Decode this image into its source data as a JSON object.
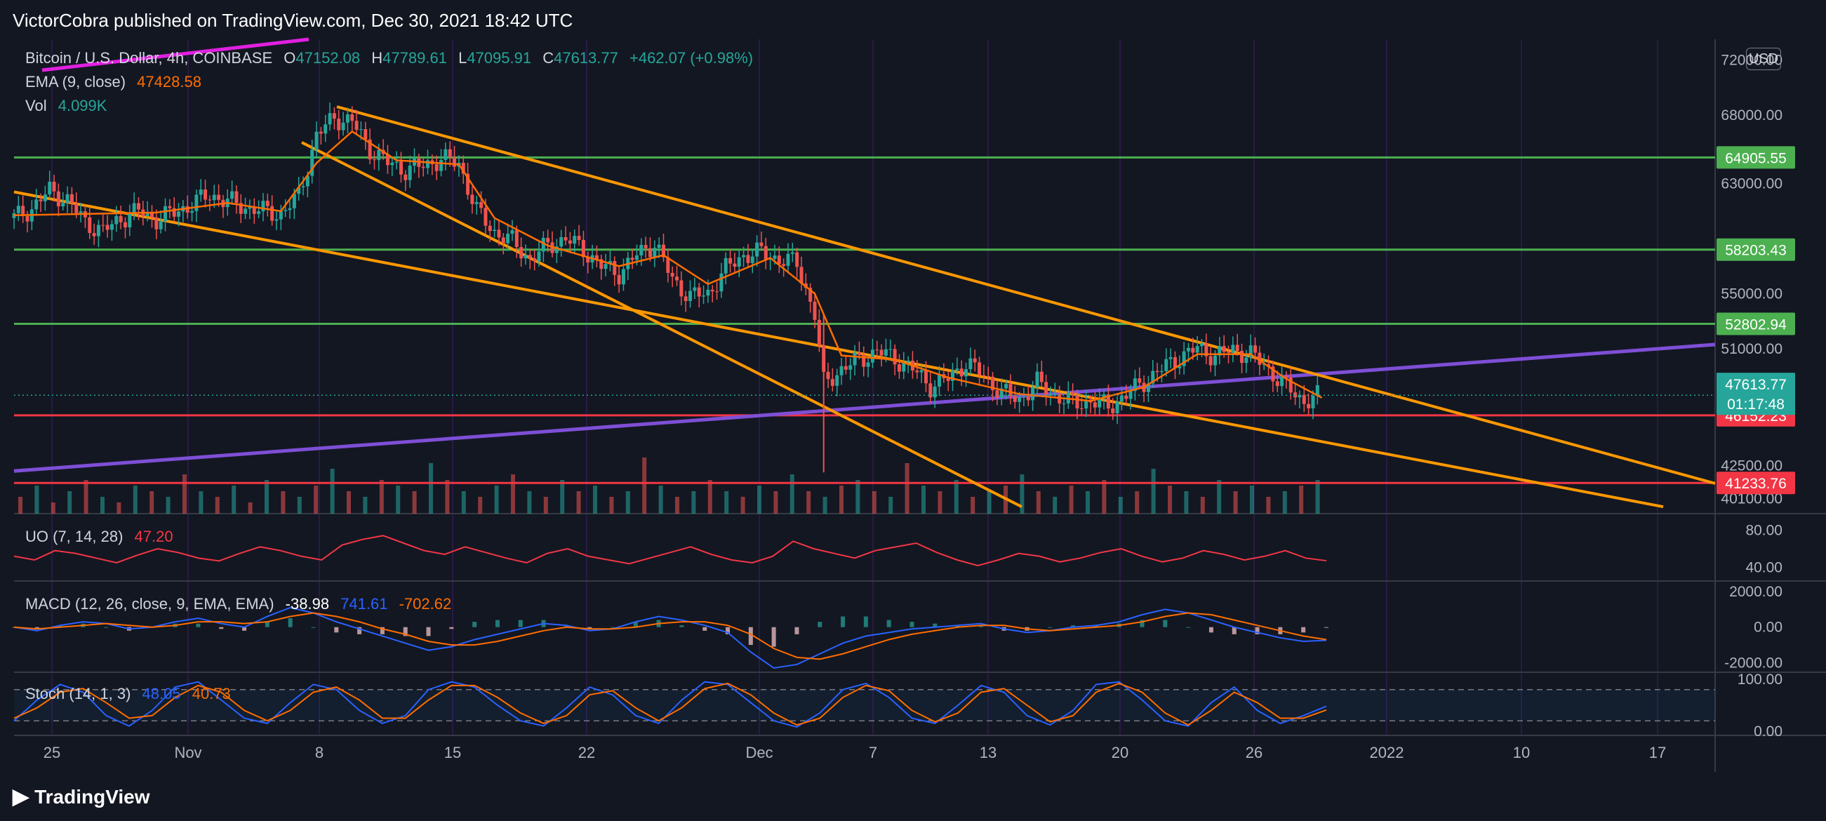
{
  "publish_line": "VictorCobra published on TradingView.com, Dec 30, 2021 18:42 UTC",
  "footer_brand": "TradingView",
  "symbol": {
    "name": "Bitcoin / U.S. Dollar, 4h, COINBASE",
    "open_label": "O",
    "open": "47152.08",
    "high_label": "H",
    "high": "47789.61",
    "low_label": "L",
    "low": "47095.91",
    "close_label": "C",
    "close": "47613.77",
    "change": "+462.07 (+0.98%)"
  },
  "ema": {
    "label": "EMA (9, close)",
    "value": "47428.58"
  },
  "vol": {
    "label": "Vol",
    "value": "4.099K"
  },
  "uo": {
    "label": "UO (7, 14, 28)",
    "value": "47.20"
  },
  "macd": {
    "label": "MACD (12, 26, close, 9, EMA, EMA)",
    "v1": "-38.98",
    "v2": "741.61",
    "v3": "-702.62"
  },
  "stoch": {
    "label": "Stoch (14, 1, 3)",
    "v1": "48.05",
    "v2": "40.73"
  },
  "currency": "USD",
  "colors": {
    "background": "#131722",
    "up": "#26a69a",
    "down": "#ef5350",
    "ema": "#ff6d00",
    "trendline": "#ff9800",
    "purple": "#7e4fd6",
    "magenta": "#e020e0",
    "green_level": "#4caf50",
    "red_level": "#f23645",
    "uo": "#f23645",
    "macd_line": "#2962ff",
    "signal_line": "#ff6d00"
  },
  "chart_data": {
    "type": "candlestick",
    "timeframe": "4h",
    "x_tick_labels": [
      "25",
      "Nov",
      "8",
      "15",
      "22",
      "Dec",
      "7",
      "13",
      "20",
      "26",
      "2022",
      "10",
      "17"
    ],
    "y_tick_labels": [
      "72000.00",
      "68000.00",
      "63000.00",
      "58000.00",
      "55000.00",
      "51000.00",
      "47000.00",
      "42500.00",
      "40100.00"
    ],
    "ylim": [
      39000,
      73500
    ],
    "price_levels": [
      {
        "value": 64905.55,
        "label": "64905.55",
        "color": "green"
      },
      {
        "value": 58203.43,
        "label": "58203.43",
        "color": "green"
      },
      {
        "value": 52802.94,
        "label": "52802.94",
        "color": "green"
      },
      {
        "value": 46152.23,
        "label": "46152.23",
        "color": "red"
      },
      {
        "value": 41233.76,
        "label": "41233.76",
        "color": "red"
      }
    ],
    "last_price": {
      "value": 47613.77,
      "label": "47613.77",
      "countdown": "01:17:48"
    },
    "price_path": [
      [
        0,
        60500
      ],
      [
        4,
        61200
      ],
      [
        8,
        62500
      ],
      [
        12,
        61800
      ],
      [
        16,
        60200
      ],
      [
        20,
        59500
      ],
      [
        24,
        60500
      ],
      [
        28,
        61000
      ],
      [
        32,
        60400
      ],
      [
        36,
        60900
      ],
      [
        40,
        61500
      ],
      [
        44,
        62200
      ],
      [
        48,
        61700
      ],
      [
        52,
        61300
      ],
      [
        56,
        61000
      ],
      [
        60,
        60800
      ],
      [
        64,
        62100
      ],
      [
        68,
        66500
      ],
      [
        72,
        67800
      ],
      [
        76,
        67500
      ],
      [
        80,
        65500
      ],
      [
        84,
        64500
      ],
      [
        88,
        64000
      ],
      [
        92,
        64300
      ],
      [
        96,
        64800
      ],
      [
        100,
        64500
      ],
      [
        104,
        61000
      ],
      [
        108,
        59500
      ],
      [
        112,
        58800
      ],
      [
        116,
        57500
      ],
      [
        120,
        58500
      ],
      [
        124,
        59000
      ],
      [
        128,
        58200
      ],
      [
        132,
        57000
      ],
      [
        136,
        56500
      ],
      [
        140,
        57800
      ],
      [
        144,
        58700
      ],
      [
        148,
        56000
      ],
      [
        152,
        54800
      ],
      [
        156,
        55000
      ],
      [
        160,
        56800
      ],
      [
        164,
        57800
      ],
      [
        168,
        58000
      ],
      [
        172,
        57500
      ],
      [
        176,
        57200
      ],
      [
        180,
        53500
      ],
      [
        182,
        48500
      ],
      [
        186,
        49500
      ],
      [
        190,
        50200
      ],
      [
        194,
        50800
      ],
      [
        198,
        50300
      ],
      [
        202,
        49500
      ],
      [
        206,
        48300
      ],
      [
        210,
        48800
      ],
      [
        214,
        50000
      ],
      [
        218,
        49000
      ],
      [
        222,
        47800
      ],
      [
        226,
        47300
      ],
      [
        230,
        48500
      ],
      [
        234,
        47600
      ],
      [
        238,
        47000
      ],
      [
        242,
        47200
      ],
      [
        246,
        46800
      ],
      [
        250,
        47600
      ],
      [
        254,
        48600
      ],
      [
        258,
        49500
      ],
      [
        262,
        50400
      ],
      [
        266,
        51000
      ],
      [
        270,
        50500
      ],
      [
        274,
        50900
      ],
      [
        278,
        50600
      ],
      [
        282,
        49500
      ],
      [
        286,
        48200
      ],
      [
        290,
        47200
      ],
      [
        294,
        47613.77
      ]
    ],
    "ema_path": [
      [
        0,
        60700
      ],
      [
        16,
        60800
      ],
      [
        32,
        60900
      ],
      [
        48,
        61600
      ],
      [
        60,
        61000
      ],
      [
        68,
        64500
      ],
      [
        76,
        66800
      ],
      [
        86,
        64700
      ],
      [
        100,
        64400
      ],
      [
        108,
        60500
      ],
      [
        120,
        58500
      ],
      [
        136,
        57000
      ],
      [
        146,
        57800
      ],
      [
        156,
        55700
      ],
      [
        170,
        57600
      ],
      [
        180,
        55000
      ],
      [
        186,
        50500
      ],
      [
        198,
        50200
      ],
      [
        210,
        48900
      ],
      [
        226,
        47700
      ],
      [
        242,
        47200
      ],
      [
        254,
        48200
      ],
      [
        266,
        50600
      ],
      [
        278,
        50600
      ],
      [
        286,
        48800
      ],
      [
        294,
        47428.58
      ]
    ],
    "volume": [
      3,
      5,
      2,
      4,
      6,
      3,
      2,
      5,
      4,
      3,
      7,
      4,
      3,
      5,
      2,
      6,
      4,
      3,
      5,
      8,
      4,
      3,
      6,
      5,
      4,
      9,
      6,
      4,
      3,
      5,
      7,
      4,
      3,
      6,
      4,
      5,
      3,
      4,
      10,
      5,
      3,
      4,
      6,
      4,
      3,
      5,
      4,
      7,
      4,
      3,
      5,
      6,
      4,
      3,
      9,
      5,
      4,
      6,
      3,
      4,
      5,
      7,
      4,
      3,
      5,
      4,
      6,
      3,
      4,
      8,
      5,
      4,
      3,
      6,
      4,
      5,
      3,
      4,
      5,
      6
    ],
    "volume_colors": "alternating",
    "uo_series": {
      "ylim": [
        30,
        90
      ],
      "ticks": [
        "80.00",
        "40.00"
      ],
      "values": [
        52,
        48,
        58,
        55,
        50,
        45,
        53,
        60,
        56,
        50,
        47,
        55,
        62,
        58,
        52,
        48,
        64,
        70,
        74,
        66,
        58,
        54,
        62,
        56,
        50,
        45,
        55,
        60,
        52,
        48,
        44,
        50,
        56,
        62,
        54,
        48,
        45,
        52,
        68,
        60,
        55,
        50,
        58,
        62,
        66,
        56,
        48,
        42,
        48,
        55,
        52,
        46,
        50,
        56,
        60,
        52,
        46,
        50,
        58,
        54,
        48,
        52,
        58,
        50,
        47.2
      ]
    },
    "macd_series": {
      "ylim": [
        -2300,
        2200
      ],
      "ticks": [
        "2000.00",
        "0.00",
        "-2000.00"
      ],
      "macd": [
        0,
        -200,
        100,
        300,
        200,
        -100,
        0,
        300,
        500,
        200,
        0,
        600,
        1100,
        800,
        300,
        -100,
        -500,
        -900,
        -1300,
        -1100,
        -700,
        -400,
        -100,
        200,
        100,
        -200,
        -100,
        300,
        600,
        400,
        100,
        -300,
        -1400,
        -2300,
        -2100,
        -1500,
        -900,
        -500,
        -300,
        -100,
        0,
        100,
        200,
        -100,
        -300,
        -200,
        0,
        100,
        300,
        700,
        1000,
        800,
        400,
        0,
        -300,
        -600,
        -800,
        -741.61
      ],
      "signal": [
        0,
        -100,
        0,
        100,
        200,
        100,
        0,
        100,
        300,
        300,
        200,
        300,
        600,
        800,
        600,
        300,
        -100,
        -400,
        -800,
        -1000,
        -1000,
        -800,
        -500,
        -200,
        0,
        -100,
        -100,
        0,
        200,
        300,
        300,
        100,
        -400,
        -1200,
        -1700,
        -1800,
        -1500,
        -1100,
        -700,
        -400,
        -200,
        0,
        100,
        100,
        -100,
        -200,
        -100,
        0,
        100,
        300,
        600,
        800,
        700,
        400,
        100,
        -200,
        -500,
        -702.62
      ]
    },
    "stoch_series": {
      "ylim": [
        0,
        100
      ],
      "ticks": [
        "100.00",
        "0.00"
      ],
      "upper_band": 80,
      "lower_band": 20,
      "k": [
        20,
        60,
        90,
        75,
        30,
        10,
        40,
        85,
        95,
        60,
        25,
        15,
        55,
        90,
        80,
        40,
        15,
        30,
        80,
        95,
        85,
        50,
        20,
        10,
        45,
        85,
        70,
        30,
        15,
        60,
        95,
        90,
        55,
        20,
        8,
        35,
        80,
        92,
        65,
        25,
        15,
        50,
        88,
        75,
        30,
        12,
        40,
        90,
        95,
        60,
        20,
        10,
        55,
        85,
        40,
        15,
        30,
        48.05
      ],
      "d": [
        25,
        45,
        75,
        82,
        55,
        25,
        30,
        65,
        88,
        75,
        40,
        20,
        40,
        75,
        85,
        60,
        25,
        25,
        60,
        88,
        88,
        65,
        35,
        15,
        30,
        70,
        78,
        45,
        20,
        45,
        82,
        92,
        70,
        35,
        12,
        25,
        65,
        88,
        78,
        40,
        18,
        35,
        75,
        82,
        50,
        18,
        30,
        75,
        92,
        75,
        35,
        12,
        40,
        75,
        55,
        25,
        25,
        40.73
      ]
    }
  }
}
